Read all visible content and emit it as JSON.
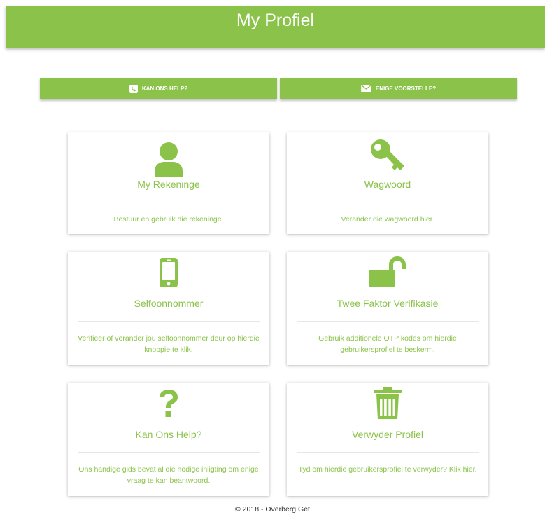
{
  "header": {
    "title": "My Profiel"
  },
  "actions": {
    "help_label": "KAN ONS HELP?",
    "suggest_label": "ENIGE VOORSTELLE?",
    "help_icon": "phone-icon",
    "suggest_icon": "envelope-icon"
  },
  "cards": [
    {
      "title": "My Rekeninge",
      "description": "Bestuur en gebruik die rekeninge.",
      "icon": "user-icon"
    },
    {
      "title": "Wagwoord",
      "description": "Verander die wagwoord hier.",
      "icon": "key-icon"
    },
    {
      "title": "Selfoonnommer",
      "description": "Verifieër of verander jou selfoonnommer deur op hierdie knoppie te klik.",
      "icon": "mobile-phone-icon"
    },
    {
      "title": "Twee Faktor Verifikasie",
      "description": "Gebruik additionele OTP kodes om hierdie gebruikersprofiel te beskerm.",
      "icon": "unlock-icon"
    },
    {
      "title": "Kan Ons Help?",
      "description": "Ons handige gids bevat al die nodige inligting om enige vraag te kan beantwoord.",
      "icon": "question-icon"
    },
    {
      "title": "Verwyder Profiel",
      "description": "Tyd om hierdie gebruikersprofiel te verwyder? Klik hier.",
      "icon": "trash-icon"
    }
  ],
  "footer": {
    "text": "© 2018 - Overberg Get"
  },
  "colors": {
    "accent": "#8bc34a",
    "text_dark": "#333333"
  }
}
